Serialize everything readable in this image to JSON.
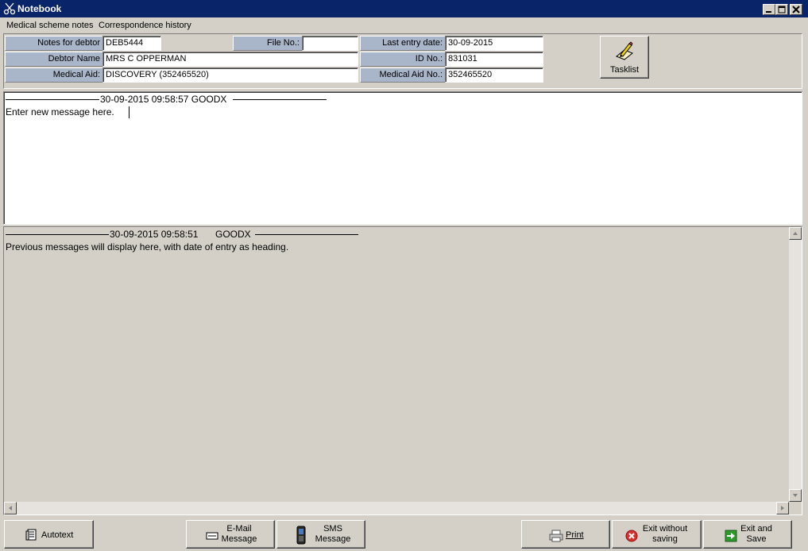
{
  "window": {
    "title": "Notebook"
  },
  "menu": {
    "items": [
      "Medical scheme notes",
      "Correspondence history"
    ]
  },
  "header": {
    "notes_for_debtor_label": "Notes for debtor",
    "notes_for_debtor_value": "DEB5444",
    "file_no_label": "File No.:",
    "file_no_value": "",
    "last_entry_date_label": "Last entry date:",
    "last_entry_date_value": "30-09-2015",
    "debtor_name_label": "Debtor Name",
    "debtor_name_value": "MRS C OPPERMAN",
    "id_no_label": "ID No.:",
    "id_no_value": "831031",
    "medical_aid_label": "Medical Aid:",
    "medical_aid_value": "DISCOVERY (352465520)",
    "medical_aid_no_label": "Medical Aid No.:",
    "medical_aid_no_value": "352465520",
    "tasklist_label": "Tasklist"
  },
  "editor": {
    "heading": "30-09-2015 09:58:57 GOODX",
    "message": "Enter new message here."
  },
  "history": {
    "heading_date": "30-09-2015 09:58:51",
    "heading_user": "GOODX",
    "message": "Previous messages will display here, with date of entry as heading."
  },
  "footer": {
    "autotext": "Autotext",
    "email_line1": "E-Mail",
    "email_line2": "Message",
    "sms_line1": "SMS",
    "sms_line2": "Message",
    "print": "Print",
    "exit_nosave_line1": "Exit without",
    "exit_nosave_line2": "saving",
    "exit_save_line1": "Exit and",
    "exit_save_line2": "Save"
  },
  "icons": {
    "app": "scissors-icon",
    "tasklist": "pencil-paper-icon",
    "autotext": "document-icon",
    "email": "envelope-icon",
    "sms": "mobile-phone-icon",
    "print": "printer-icon",
    "exit_without_saving": "red-x-icon",
    "exit_and_save": "green-arrow-icon"
  },
  "colors": {
    "titlebar": "#0a246a",
    "label_background": "#a9b5c8",
    "window_background": "#d4d0c8"
  }
}
